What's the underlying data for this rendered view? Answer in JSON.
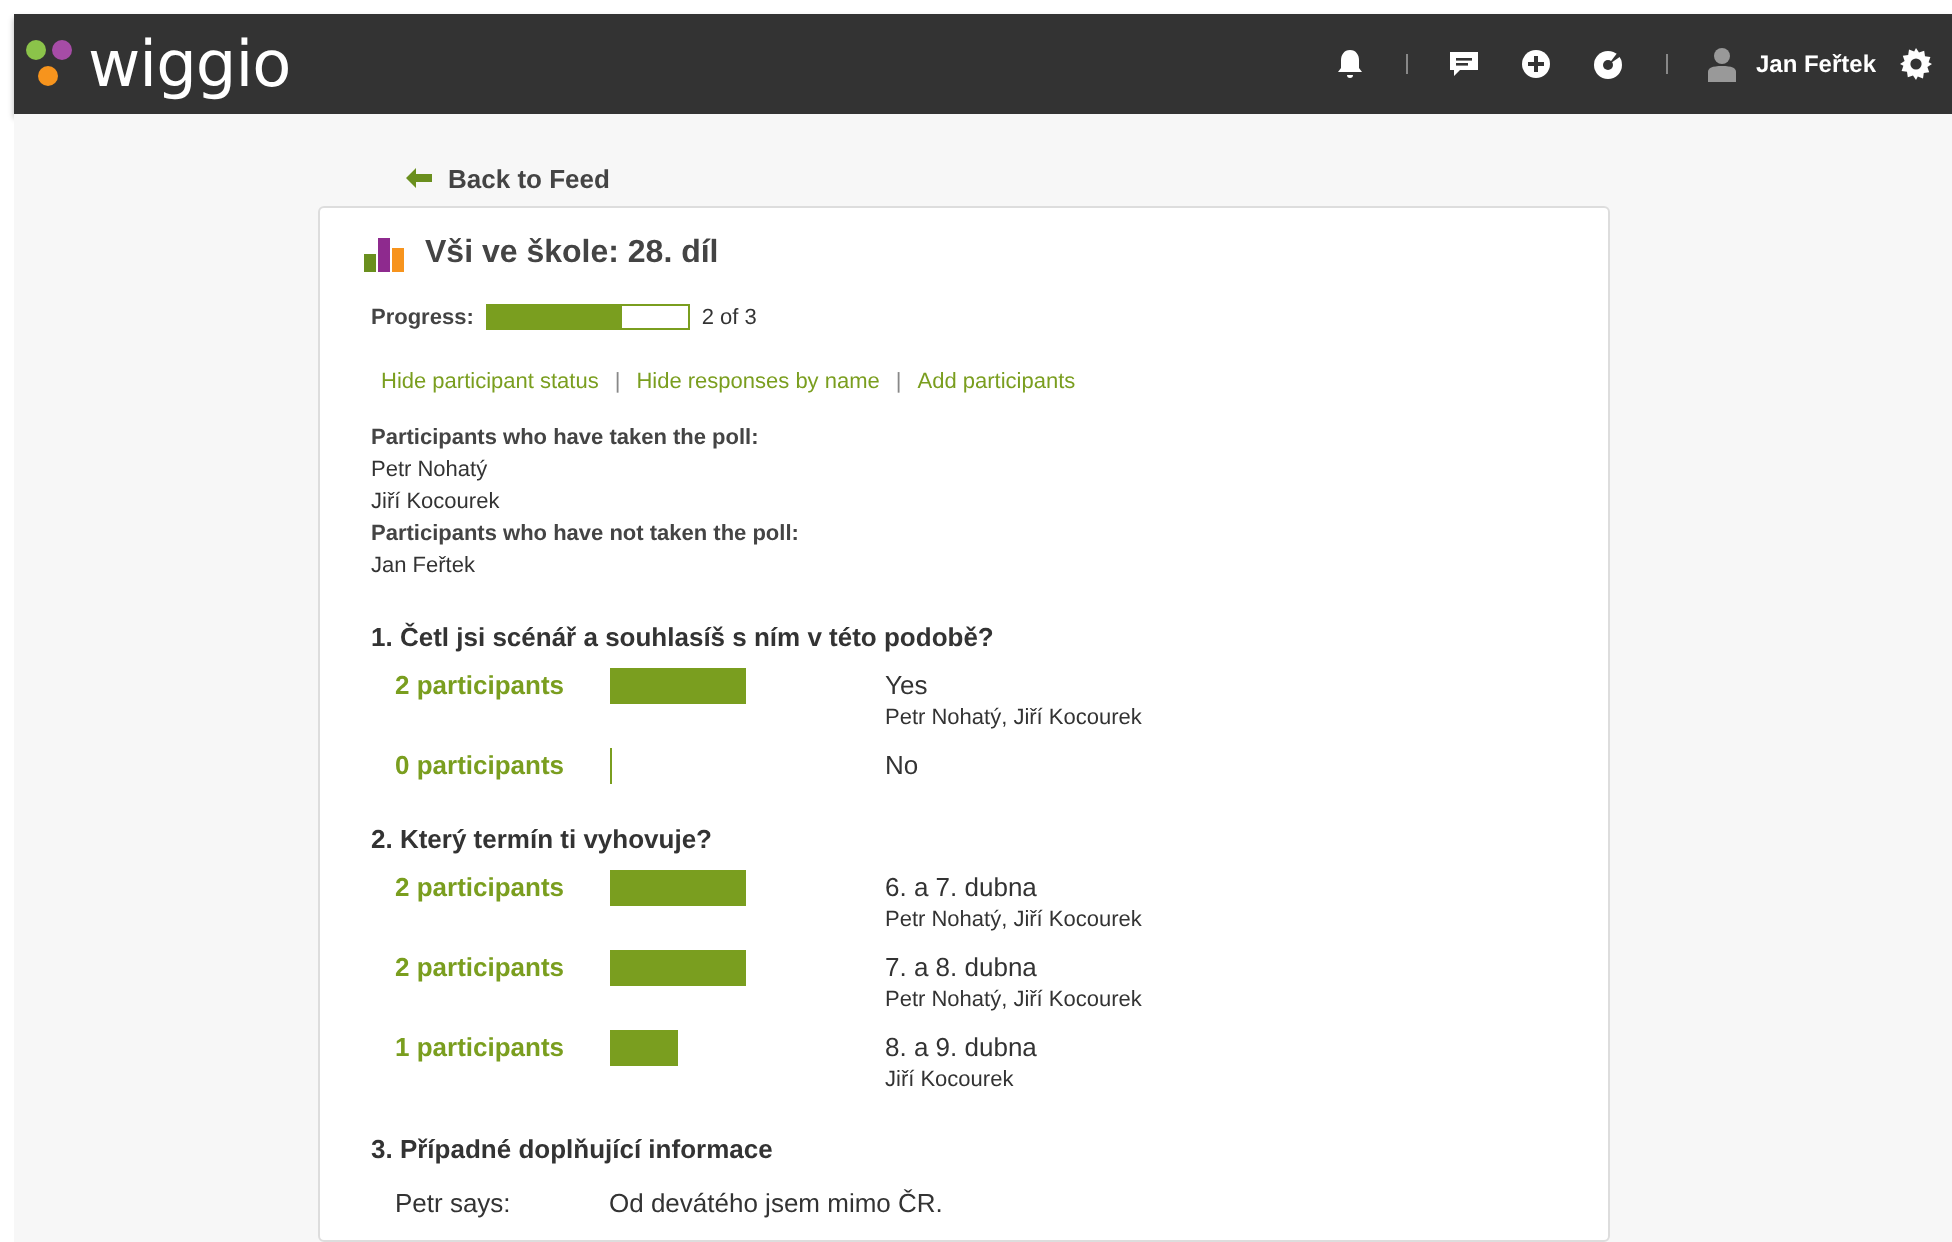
{
  "header": {
    "logo": "wiggio",
    "user": "Jan Feřtek"
  },
  "back_link": "Back to Feed",
  "poll": {
    "title": "Vši ve škole: 28. díl",
    "progress": {
      "label": "Progress:",
      "level": 0.67,
      "reading": "2 of 3"
    },
    "links": [
      "Hide participant status",
      "Hide responses by name",
      "Add participants"
    ],
    "link_separator": "|",
    "status": [
      {
        "kind": "heading",
        "text": "Participants who have taken the poll:"
      },
      {
        "kind": "name",
        "text": "Petr Nohatý"
      },
      {
        "kind": "name",
        "text": "Jiří Kocourek"
      },
      {
        "kind": "heading",
        "text": "Participants who have not taken the poll:"
      },
      {
        "kind": "name",
        "text": "Jan Feřtek"
      }
    ],
    "questions": [
      {
        "kind": "choice",
        "title": "1. Četl jsi scénář a souhlasíš s ním v této podobě?",
        "answers": [
          {
            "count": "2 participants",
            "option": "Yes",
            "names": "Petr Nohatý, Jiří Kocourek"
          },
          {
            "count": "0 participants",
            "option": "No"
          }
        ]
      },
      {
        "kind": "choice",
        "title": "2. Který termín ti vyhovuje?",
        "answers": [
          {
            "count": "2 participants",
            "option": "6. a 7. dubna",
            "names": "Petr Nohatý, Jiří Kocourek"
          },
          {
            "count": "2 participants",
            "option": "7. a 8. dubna",
            "names": "Petr Nohatý, Jiří Kocourek"
          },
          {
            "count": "1 participants",
            "option": "8. a 9. dubna",
            "names": "Jiří Kocourek"
          }
        ]
      },
      {
        "kind": "text",
        "title": "3. Případné doplňující informace",
        "responses": [
          {
            "who": "Petr says:",
            "text": "Od devátého jsem mimo ČR."
          }
        ]
      }
    ]
  }
}
